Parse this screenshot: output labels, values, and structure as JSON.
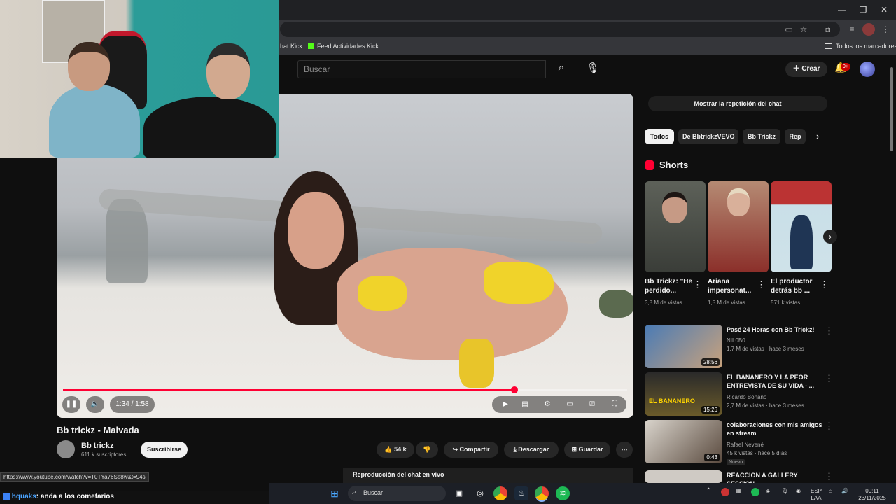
{
  "window": {
    "minimize_glyph": "—",
    "maximize_glyph": "❐",
    "close_glyph": "✕"
  },
  "bookmarks": {
    "item1": "hat Kick",
    "item2": "Feed Actividades Kick",
    "all": "Todos los marcadores"
  },
  "header": {
    "search_placeholder": "Buscar",
    "create_label": "Crear",
    "notif_count": "9+"
  },
  "video": {
    "title": "Bb trickz - Malvada",
    "time": "1:34 / 1:58",
    "progress_fraction": 0.8,
    "channel": {
      "name": "Bb trickz",
      "subs": "611 k suscriptores"
    },
    "subscribe_label": "Suscribirse",
    "likes": "54 k",
    "share_label": "Compartir",
    "download_label": "Descargar",
    "save_label": "Guardar",
    "chat_replay_label": "Reproducción del chat en vivo"
  },
  "sidebar": {
    "show_chat_label": "Mostrar la repetición del chat",
    "chips": [
      "Todos",
      "De BbtrickzVEVO",
      "Bb Trickz",
      "Rep"
    ],
    "shorts_heading": "Shorts",
    "shorts": [
      {
        "title": "Bb Trickz: \"He perdido...",
        "views": "3,8 M de vistas"
      },
      {
        "title": "Ariana impersonat...",
        "views": "1,5 M de vistas"
      },
      {
        "title": "El productor detrás bb ...",
        "views": "571 k vistas"
      }
    ],
    "recommendations": [
      {
        "title": "Pasé 24 Horas con Bb Trickz!",
        "channel": "NIL0B0",
        "meta": "1,7 M de vistas · hace 3 meses",
        "duration": "28:56",
        "badge": ""
      },
      {
        "title": "EL BANANERO Y LA PEOR ENTREVISTA DE SU VIDA - ...",
        "channel": "Ricardo Bonano",
        "meta": "2,7 M de vistas · hace 3 meses",
        "duration": "15:26",
        "badge": ""
      },
      {
        "title": "colaboraciones con mis amigos en stream",
        "channel": "Rafael Nevené",
        "meta": "45 k vistas · hace 5 días",
        "duration": "0:43",
        "badge": "Nuevo"
      },
      {
        "title": "REACCION A GALLERY SESSION",
        "channel": "",
        "meta": "",
        "duration": "",
        "badge": ""
      }
    ]
  },
  "statusbar": {
    "url": "https://www.youtube.com/watch?v=T0TYa76Se8w&t=94s"
  },
  "kick_chat": {
    "user": "hquaks",
    "message": ": anda a los cometarios"
  },
  "taskbar": {
    "search_label": "Buscar",
    "lang": "ESP",
    "region": "LAA",
    "time": "00:11",
    "date": "23/11/2025"
  }
}
